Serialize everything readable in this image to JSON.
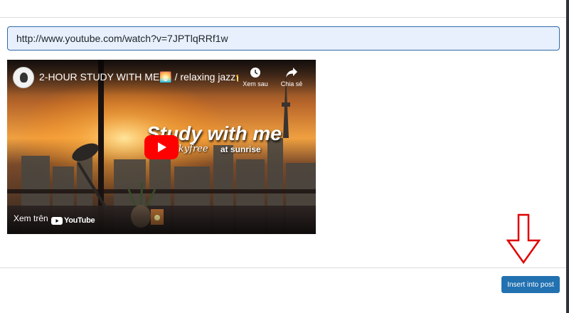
{
  "url_input": {
    "value": "http://www.youtube.com/watch?v=7JPTlqRRf1w"
  },
  "video": {
    "title": "2-HOUR STUDY WITH ME🌅 / relaxing jazz🎷 ...",
    "watch_later_label": "Xem sau",
    "share_label": "Chia sẻ",
    "overlay_title": "Study with me",
    "overlay_script": "Skyfree",
    "overlay_subtitle": "at sunrise",
    "watch_on_label": "Xem trên",
    "youtube_logo_text": "YouTube"
  },
  "footer": {
    "insert_label": "Insert into post"
  },
  "colors": {
    "primary": "#2271b1",
    "arrow": "#e00000",
    "youtube_red": "#ff0000"
  }
}
